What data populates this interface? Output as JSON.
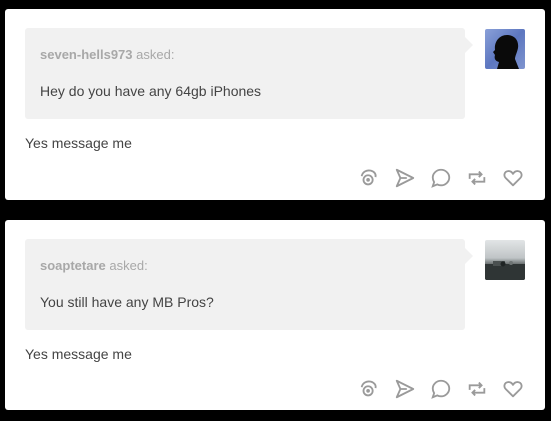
{
  "posts": [
    {
      "asker": "seven-hells973",
      "asked_label": "asked:",
      "question": "Hey do you have any 64gb iPhones",
      "answer": "Yes message me",
      "avatar_icon": "silhouette-avatar-icon"
    },
    {
      "asker": "soaptetare",
      "asked_label": "asked:",
      "question": "You still have any MB Pros?",
      "answer": "Yes message me",
      "avatar_icon": "landscape-avatar-icon"
    }
  ],
  "actions": [
    "notes-icon",
    "share-icon",
    "reply-icon",
    "reblog-icon",
    "like-icon"
  ],
  "colors": {
    "background": "#000000",
    "card": "#ffffff",
    "bubble": "#f1f1f1",
    "muted_text": "#a8a8a8",
    "body_text": "#444444",
    "icon": "#9a9a9a"
  }
}
